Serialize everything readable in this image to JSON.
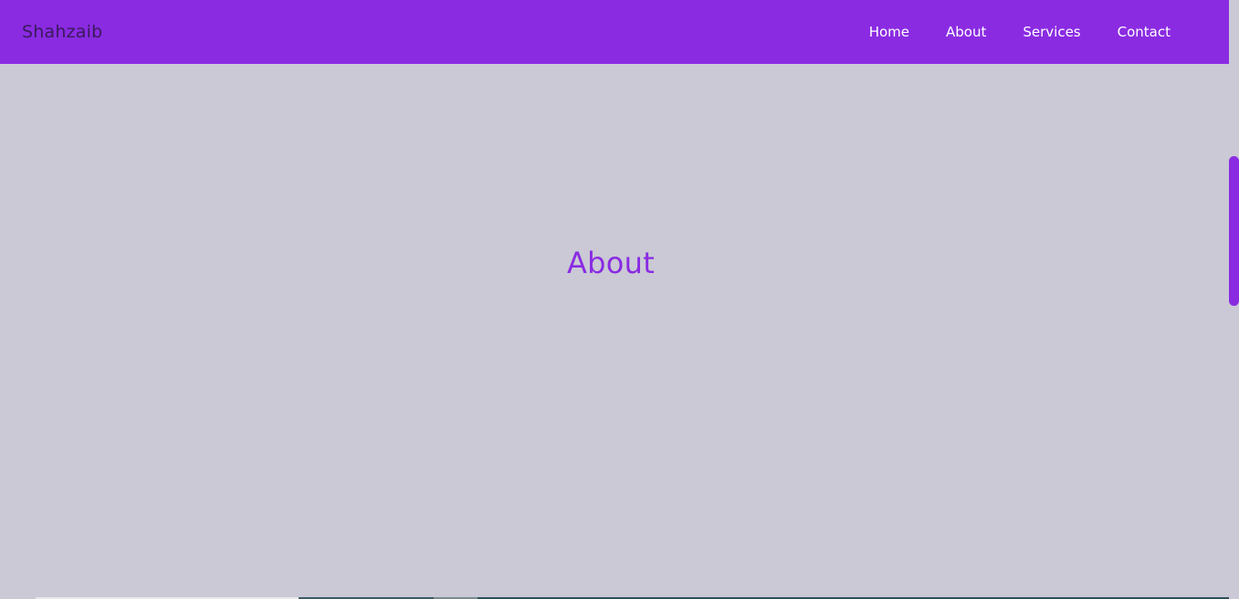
{
  "colors": {
    "nav_bg": "#8a2be2",
    "brand_text": "#3a1a5c",
    "heading": "#8a2be2",
    "page_bg": "#cac9d5",
    "scroll_thumb": "#8a2be2"
  },
  "navbar": {
    "brand": "Shahzaib",
    "links": [
      {
        "label": "Home"
      },
      {
        "label": "About"
      },
      {
        "label": "Services"
      },
      {
        "label": "Contact"
      }
    ]
  },
  "main": {
    "title": "About"
  },
  "bottom_strip": [
    {
      "color": "#cac9d5"
    },
    {
      "color": "#e8e8ec"
    },
    {
      "color": "#3d5a66"
    },
    {
      "color": "#7a8a90"
    },
    {
      "color": "#2f4f5a"
    }
  ]
}
